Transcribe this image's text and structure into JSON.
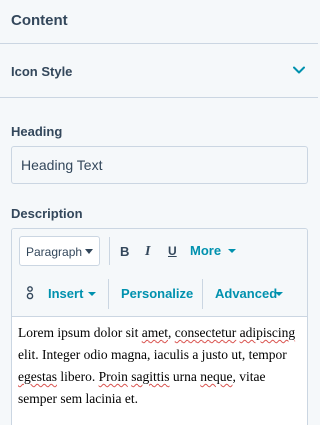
{
  "sections": {
    "content_title": "Content",
    "icon_style_title": "Icon Style"
  },
  "heading": {
    "label": "Heading",
    "value": "Heading Text"
  },
  "description": {
    "label": "Description",
    "toolbar": {
      "paragraph_select": "Paragraph",
      "bold": "B",
      "italic": "I",
      "underline": "U",
      "more": "More",
      "insert": "Insert",
      "personalize": "Personalize",
      "advanced": "Advanced"
    },
    "body": {
      "t1": "Lorem ipsum dolor sit ",
      "w1": "amet",
      "t2": ", ",
      "w2": "consectetur",
      "t3": " ",
      "w3": "adipiscing",
      "t4": " elit. Integer odio magna, iaculis a justo ut, tempor ",
      "w4": "egestas",
      "t5": " libero. ",
      "w5": "Proin",
      "t6": " ",
      "w6": "sagittis",
      "t7": " urna ",
      "w7": "neque",
      "t8": ", vitae semper sem lacinia et."
    }
  },
  "colors": {
    "accent": "#0091ae",
    "text": "#33475b",
    "border": "#cbd6e2",
    "background": "#f5f8fa"
  },
  "icons": {
    "collapse": "chevron-down-icon",
    "token": "personalization-token-icon"
  }
}
